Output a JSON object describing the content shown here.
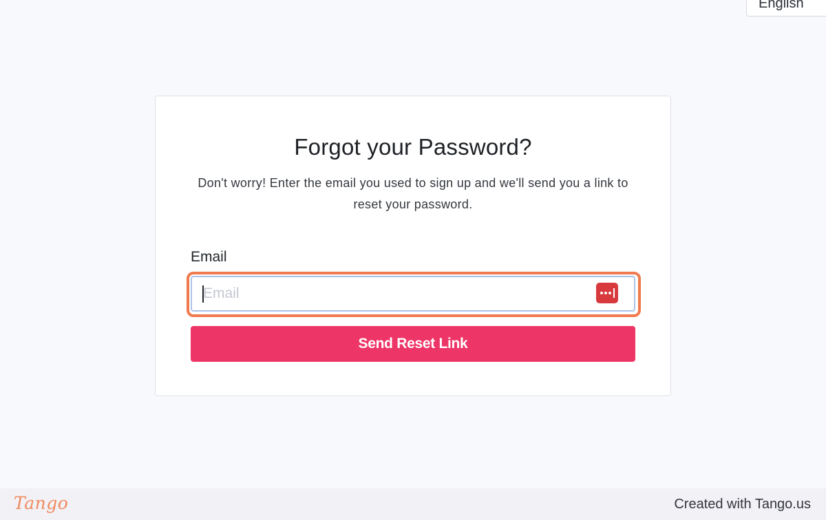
{
  "header": {
    "language_label": "English"
  },
  "form": {
    "title": "Forgot your Password?",
    "description": "Don't worry! Enter the email you used to sign up and we'll send you a link to reset your password.",
    "email_label": "Email",
    "email_placeholder": "Email",
    "email_value": "",
    "submit_label": "Send Reset Link",
    "password_manager_icon": "password-manager-dots-icon"
  },
  "footer": {
    "logo_text": "Tango",
    "credit": "Created with Tango.us"
  },
  "colors": {
    "page_background": "#f8f9fc",
    "accent_button": "#ee3567",
    "focus_highlight": "#f07a4d",
    "password_manager": "#d8393c",
    "tango_logo": "#f08a5d"
  }
}
